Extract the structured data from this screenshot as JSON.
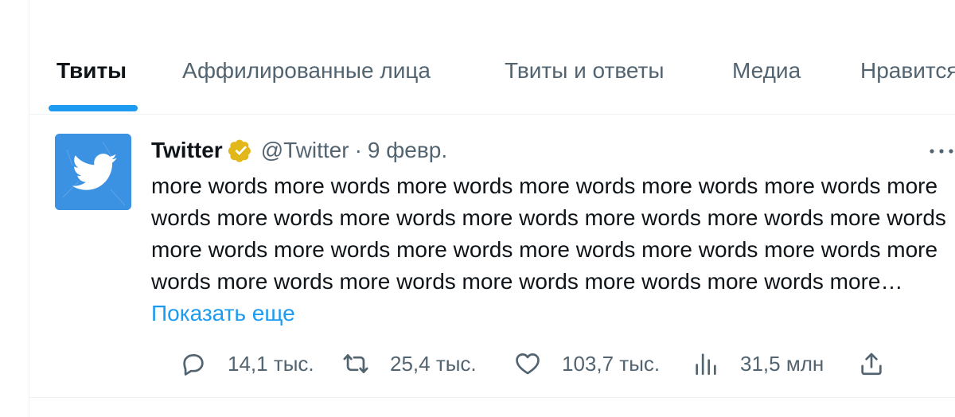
{
  "tabs": [
    {
      "label": "Твиты",
      "active": true
    },
    {
      "label": "Аффилированные лица",
      "active": false
    },
    {
      "label": "Твиты и ответы",
      "active": false
    },
    {
      "label": "Медиа",
      "active": false
    },
    {
      "label": "Нравится",
      "active": false
    }
  ],
  "tweet": {
    "author_name": "Twitter",
    "verified_badge": "gold-verified-icon",
    "handle": "@Twitter",
    "separator": "·",
    "date": "9 февр.",
    "text": "more words more words more words more words more words more words more words more words more words more words more words more words more words more words more words more words more words more words more words more words more words more words more words more words more words more…",
    "show_more_label": "Показать еще",
    "stats": {
      "replies": "14,1 тыс.",
      "retweets": "25,4 тыс.",
      "likes": "103,7 тыс.",
      "views": "31,5 млн"
    }
  },
  "colors": {
    "accent": "#1d9bf0",
    "muted": "#536471",
    "text": "#0f1419",
    "avatar_bg": "#3b91e2",
    "verified_gold": "#e2b719"
  }
}
